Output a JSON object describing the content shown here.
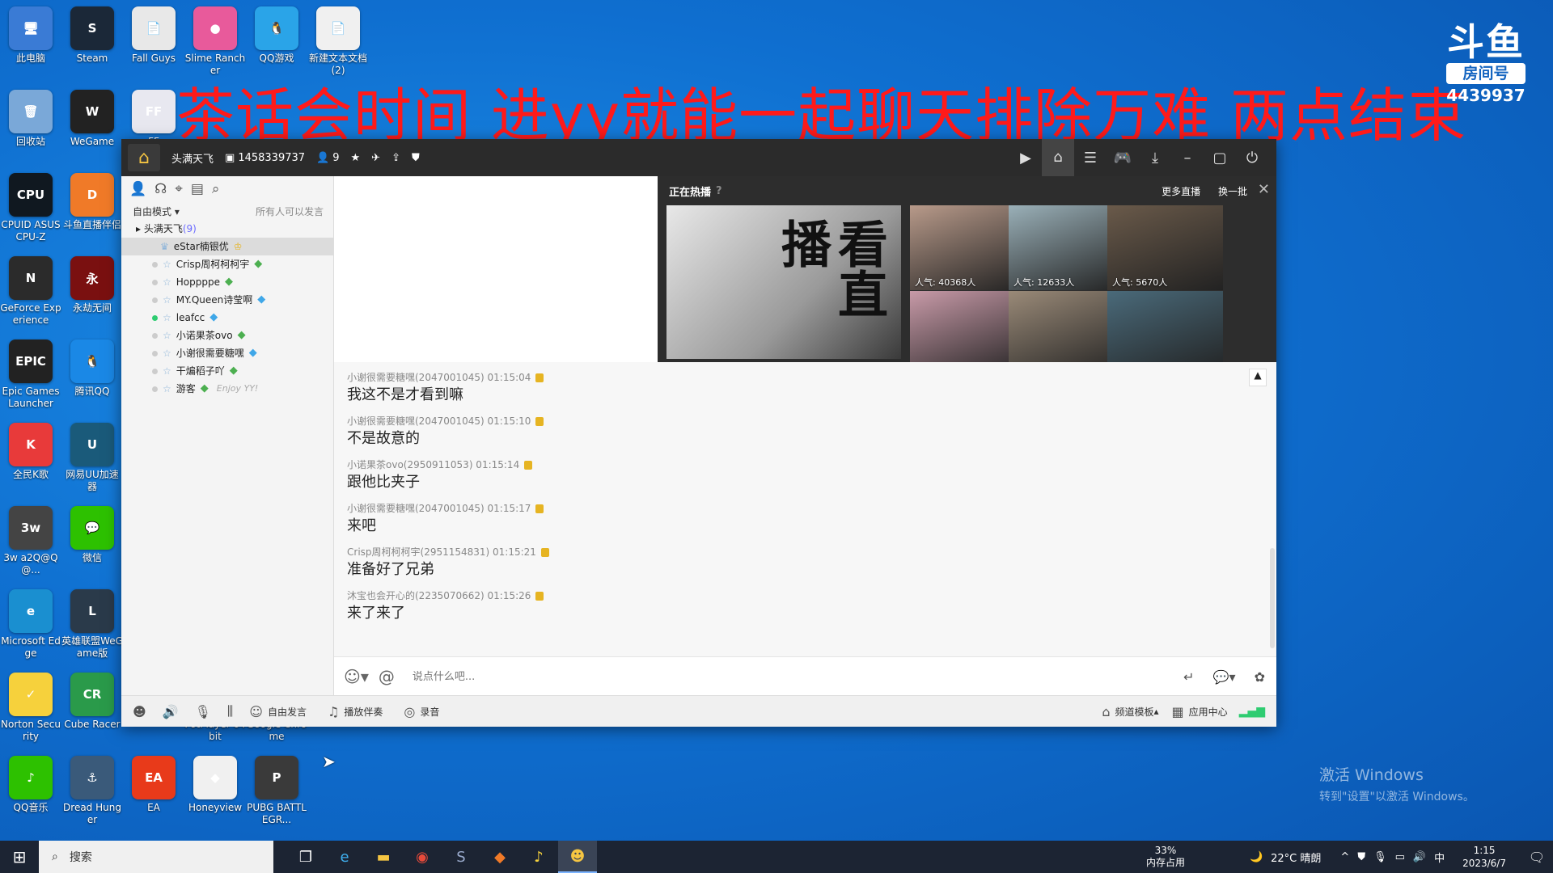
{
  "desktop": {
    "icons": [
      {
        "label": "此电脑",
        "glyph": "🖥",
        "color": "#3a7bd5"
      },
      {
        "label": "Steam",
        "glyph": "S",
        "color": "#1b2838"
      },
      {
        "label": "Fall Guys",
        "glyph": "📄",
        "color": "#e8e8e8"
      },
      {
        "label": "Slime Rancher",
        "glyph": "●",
        "color": "#e85a9b"
      },
      {
        "label": "QQ游戏",
        "glyph": "🐧",
        "color": "#2aa4e8"
      },
      {
        "label": "新建文本文档 (2)",
        "glyph": "📄",
        "color": "#f0f0f0"
      },
      {
        "label": "回收站",
        "glyph": "🗑",
        "color": "#7aa8d8"
      },
      {
        "label": "WeGame",
        "glyph": "W",
        "color": "#222"
      },
      {
        "label": "CPUID ASUS CPU-Z",
        "glyph": "CPU",
        "color": "#101820"
      },
      {
        "label": "斗鱼直播伴侣",
        "glyph": "D",
        "color": "#f07a28"
      },
      {
        "label": "GeForce Experience",
        "glyph": "N",
        "color": "#2b2b2b"
      },
      {
        "label": "永劫无间",
        "glyph": "永",
        "color": "#7a1010"
      },
      {
        "label": "Epic Games Launcher",
        "glyph": "EPIC",
        "color": "#222"
      },
      {
        "label": "腾讯QQ",
        "glyph": "🐧",
        "color": "#1a88e6"
      },
      {
        "label": "全民K歌",
        "glyph": "K",
        "color": "#e83a3a"
      },
      {
        "label": "网易UU加速器",
        "glyph": "U",
        "color": "#1a5a7a"
      },
      {
        "label": "3w a2Q@Q@...",
        "glyph": "3w",
        "color": "#444"
      },
      {
        "label": "微信",
        "glyph": "💬",
        "color": "#2dc100"
      },
      {
        "label": "Microsoft Edge",
        "glyph": "e",
        "color": "#1a8fd0"
      },
      {
        "label": "英雄联盟WeGame版",
        "glyph": "L",
        "color": "#2a3a4a"
      },
      {
        "label": "Norton Security",
        "glyph": "✓",
        "color": "#f6d13c"
      },
      {
        "label": "Cube Racer",
        "glyph": "CR",
        "color": "#2a9a4a"
      },
      {
        "label": "PotPlayer 64 bit",
        "glyph": "▶",
        "color": "#e8a028"
      },
      {
        "label": "Google Chrome",
        "glyph": "◎",
        "color": "#e8e8e8"
      },
      {
        "label": "QQ音乐",
        "glyph": "♪",
        "color": "#2dc100"
      },
      {
        "label": "Dread Hunger",
        "glyph": "⚓",
        "color": "#3a5a7a"
      },
      {
        "label": "EA",
        "glyph": "EA",
        "color": "#e83a1a"
      },
      {
        "label": "Honeyview",
        "glyph": "◆",
        "color": "#f0f0f0"
      },
      {
        "label": "PUBG BATTLEGR...",
        "glyph": "P",
        "color": "#3a3a3a"
      },
      {
        "label": "FF",
        "glyph": "FF",
        "color": "#e8e8f0"
      }
    ]
  },
  "overlay": {
    "banner": "茶话会时间 进yy就能一起聊天排除万难 两点结束",
    "douyu_logo": "斗鱼",
    "room_label": "房间号",
    "room_number": "4439937"
  },
  "yy": {
    "title": {
      "channel": "头满天飞",
      "id": "1458339737",
      "members": "9"
    },
    "left": {
      "mode": "自由模式",
      "permission": "所有人可以发言",
      "channel_root": "头满天飞",
      "channel_count": "(9)",
      "members": [
        {
          "name": "eStar楠银优",
          "gem": "crown",
          "online": true,
          "sel": true,
          "tag": ""
        },
        {
          "name": "Crisp周柯柯柯宇",
          "gem": "green",
          "online": false,
          "sel": false,
          "tag": ""
        },
        {
          "name": "Hoppppe",
          "gem": "green",
          "online": false,
          "sel": false,
          "tag": ""
        },
        {
          "name": "MY.Queen诗莹啊",
          "gem": "blue",
          "online": false,
          "sel": false,
          "tag": ""
        },
        {
          "name": "leafcc",
          "gem": "blue",
          "online": true,
          "sel": false,
          "tag": ""
        },
        {
          "name": "小诺果茶ovo",
          "gem": "green",
          "online": false,
          "sel": false,
          "tag": ""
        },
        {
          "name": "小谢很需要糖嘿",
          "gem": "blue",
          "online": false,
          "sel": false,
          "tag": ""
        },
        {
          "name": "干煸稻子吖",
          "gem": "green",
          "online": false,
          "sel": false,
          "tag": ""
        },
        {
          "name": "游客",
          "gem": "green",
          "online": false,
          "sel": false,
          "tag": "Enjoy YY!"
        }
      ]
    },
    "hot": {
      "title": "正在热播",
      "more": "更多直播",
      "refresh": "换一批",
      "big_text": "看直播",
      "thumbs": [
        {
          "pop": "人气: 40368人",
          "color": "#b89a8a"
        },
        {
          "pop": "人气: 12633人",
          "color": "#9ab0b8"
        },
        {
          "pop": "人气: 5670人",
          "color": "#6a5a4a"
        },
        {
          "pop": "",
          "color": "#c89aa8"
        },
        {
          "pop": "",
          "color": "#9a8a78"
        },
        {
          "pop": "",
          "color": "#4a6a7a"
        }
      ]
    },
    "messages": [
      {
        "meta": "小谢很需要糖嘿(2047001045)  01:15:04",
        "text": "我这不是才看到嘛"
      },
      {
        "meta": "小谢很需要糖嘿(2047001045)  01:15:10",
        "text": "不是故意的"
      },
      {
        "meta": "小诺果茶ovo(2950911053)  01:15:14",
        "text": "跟他比夹子"
      },
      {
        "meta": "小谢很需要糖嘿(2047001045)  01:15:17",
        "text": "来吧"
      },
      {
        "meta": "Crisp周柯柯柯宇(2951154831)  01:15:21",
        "text": "准备好了兄弟"
      },
      {
        "meta": "沐宝也会开心的(2235070662)  01:15:26",
        "text": "来了来了"
      }
    ],
    "input_placeholder": "说点什么吧...",
    "bottom": {
      "free_speech": "自由发言",
      "play_music": "播放伴奏",
      "record": "录音",
      "template": "频道模板",
      "app_center": "应用中心"
    }
  },
  "activate": {
    "line1": "激活 Windows",
    "line2": "转到\"设置\"以激活 Windows。"
  },
  "taskbar": {
    "search": "搜索",
    "memory_pct": "33%",
    "memory_label": "内存占用",
    "weather": "22°C  晴朗",
    "ime": "中",
    "time": "1:15",
    "date": "2023/6/7"
  }
}
